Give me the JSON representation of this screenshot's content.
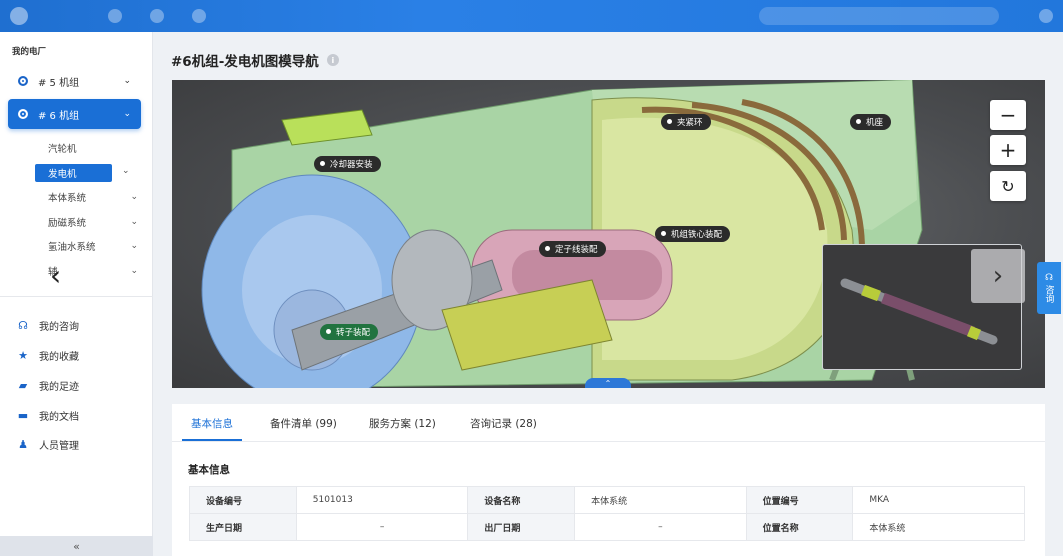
{
  "sidebar": {
    "title": "我的电厂",
    "units": [
      {
        "label": "# 5 机组",
        "active": false
      },
      {
        "label": "# 6 机组",
        "active": true
      }
    ],
    "subitems": [
      "汽轮机",
      "发电机",
      "本体系统",
      "励磁系统",
      "氢油水系统",
      "辅"
    ],
    "nav": [
      {
        "label": "我的咨询",
        "icon": "headset-icon"
      },
      {
        "label": "我的收藏",
        "icon": "star-icon"
      },
      {
        "label": "我的足迹",
        "icon": "footprint-icon"
      },
      {
        "label": "我的文档",
        "icon": "folder-icon"
      },
      {
        "label": "人员管理",
        "icon": "person-icon"
      }
    ],
    "collapse": "«"
  },
  "main": {
    "title": "#6机组-发电机图模导航",
    "info": "i",
    "viewer": {
      "zoom_out": "−",
      "zoom_in": "+",
      "reset": "↻",
      "tags": [
        "夹紧环",
        "机座",
        "冷却器安装",
        "机组铁心装配",
        "定子线装配",
        "转子装配"
      ],
      "prev": "‹",
      "next": "›",
      "up": "⌃"
    },
    "tabs": [
      "基本信息",
      "备件清单 (99)",
      "服务方案 (12)",
      "咨询记录 (28)"
    ],
    "section_title": "基本信息",
    "rows": [
      [
        "设备编号",
        "5101013",
        "设备名称",
        "本体系统",
        "位置编号",
        "MKA"
      ],
      [
        "生产日期",
        "–",
        "出厂日期",
        "–",
        "位置名称",
        "本体系统"
      ]
    ]
  },
  "float_tab": "咨询",
  "colors": {
    "accent": "#1a6fd6"
  }
}
